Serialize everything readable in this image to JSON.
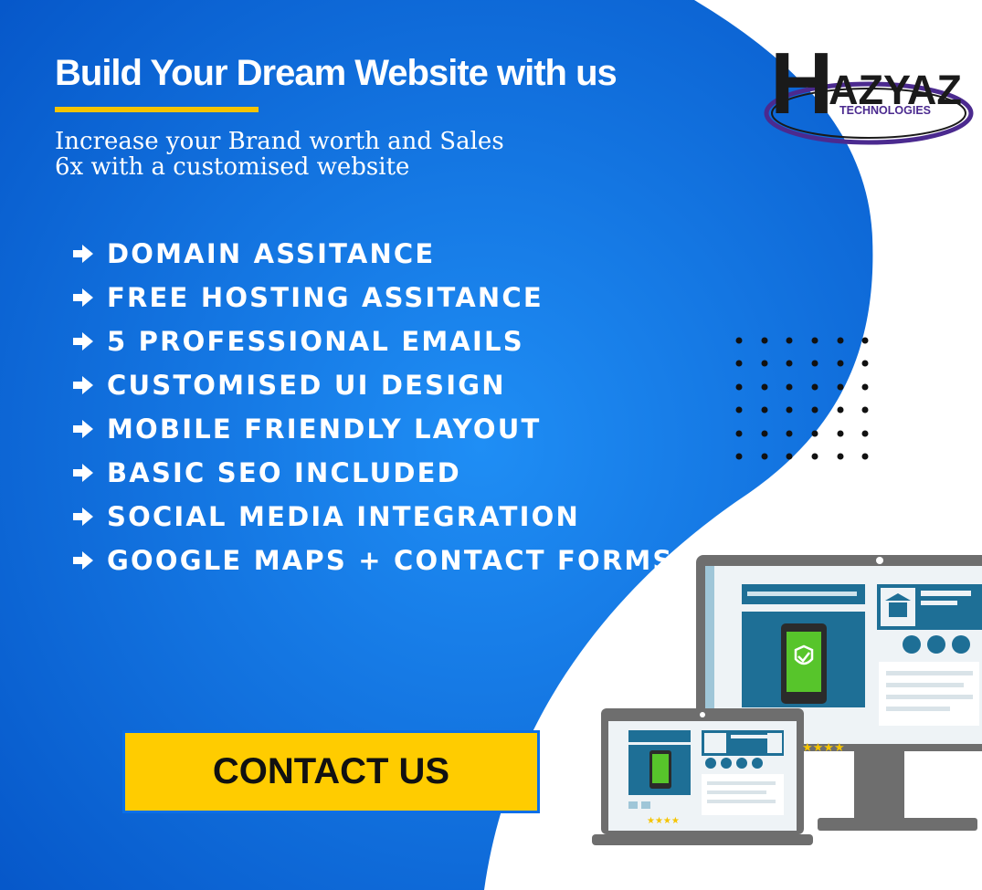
{
  "headline": "Build Your Dream Website with us",
  "subtitle_lines": [
    "Increase your Brand worth and Sales",
    "6x with a customised website"
  ],
  "features": [
    "DOMAIN ASSITANCE",
    "FREE HOSTING ASSITANCE",
    "5 PROFESSIONAL EMAILS",
    "CUSTOMISED UI DESIGN",
    "MOBILE FRIENDLY LAYOUT",
    "BASIC SEO INCLUDED",
    "SOCIAL MEDIA INTEGRATION",
    "GOOGLE MAPS + CONTACT FORMS"
  ],
  "cta": {
    "label": "CONTACT US"
  },
  "logo": {
    "letter": "H",
    "name": "AZYAZ",
    "tagline": "TECHNOLOGIES"
  },
  "icons": {
    "bullet": "arrow-right-icon",
    "devices": "desktop-and-laptop-illustration",
    "shield": "shield-check-icon"
  },
  "colors": {
    "blue": "#0a6fe8",
    "accent": "#f5c400",
    "cta_bg": "#ffcc00",
    "logo_purple": "#4b2a8f",
    "device_gray": "#6e6e6e",
    "screen_teal": "#1e6f96"
  }
}
